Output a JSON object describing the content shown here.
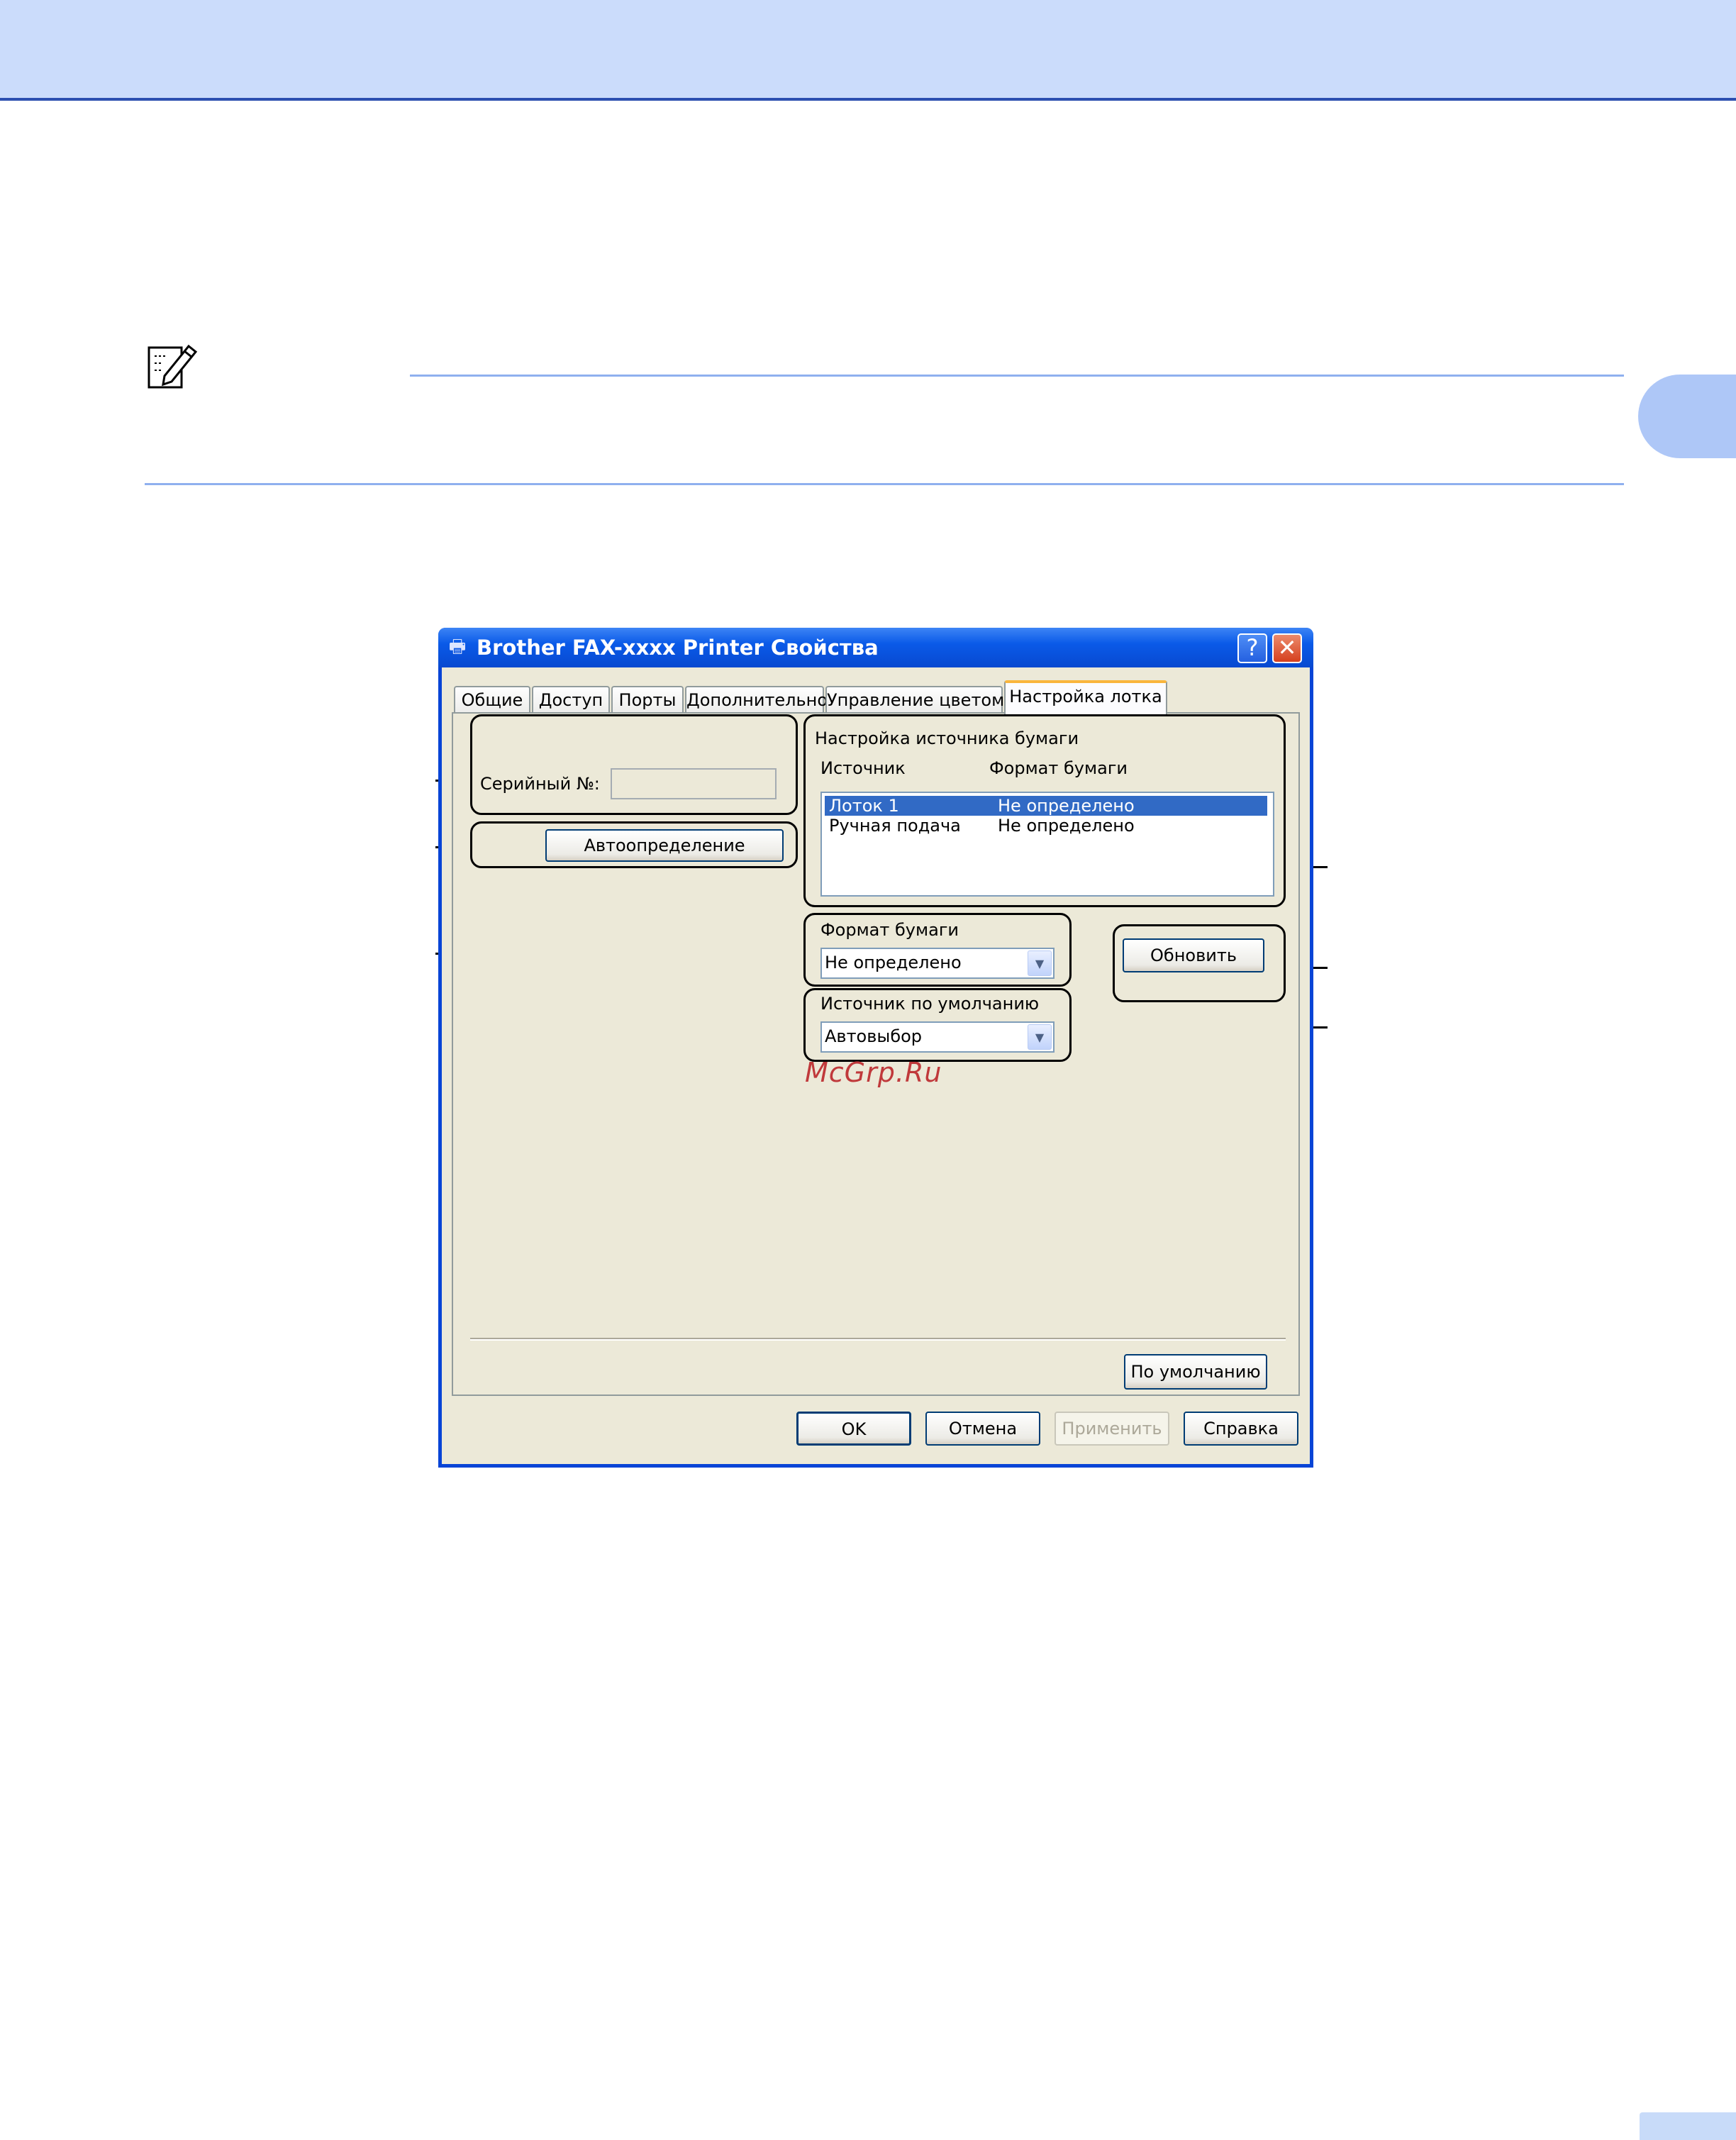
{
  "dialog": {
    "title": "Brother FAX-xxxx Printer Свойства",
    "help_glyph": "?",
    "close_glyph": "✕",
    "tabs": [
      {
        "label": "Общие"
      },
      {
        "label": "Доступ"
      },
      {
        "label": "Порты"
      },
      {
        "label": "Дополнительно"
      },
      {
        "label": "Управление цветом"
      },
      {
        "label": "Настройка лотка",
        "active": true
      }
    ]
  },
  "tray_settings": {
    "serial_label": "Серийный №:",
    "serial_value": "",
    "autodetect_label": "Автоопределение",
    "paper_source": {
      "group_label": "Настройка источника бумаги",
      "col_source": "Источник",
      "col_format": "Формат бумаги",
      "rows": [
        {
          "source": "Лоток 1",
          "format": "Не определено",
          "selected": true
        },
        {
          "source": "Ручная подача",
          "format": "Не определено",
          "selected": false
        }
      ]
    },
    "paper_format": {
      "label": "Формат бумаги",
      "value": "Не определено"
    },
    "update_label": "Обновить",
    "default_source": {
      "label": "Источник по умолчанию",
      "value": "Автовыбор"
    },
    "defaults_label": "По умолчанию"
  },
  "footer_buttons": {
    "ok": "OK",
    "cancel": "Отмена",
    "apply": "Применить",
    "help": "Справка"
  },
  "watermark": "McGrp.Ru",
  "colors": {
    "banner": "#cbdcfb",
    "accent": "#2c4fb0",
    "xp_title": "#0a5ae8",
    "selection": "#316ac5",
    "dialog_face": "#ece9d8"
  },
  "icons": {
    "note": "note-pencil-icon",
    "printer": "printer-icon",
    "combo": "chevron-down-icon"
  }
}
